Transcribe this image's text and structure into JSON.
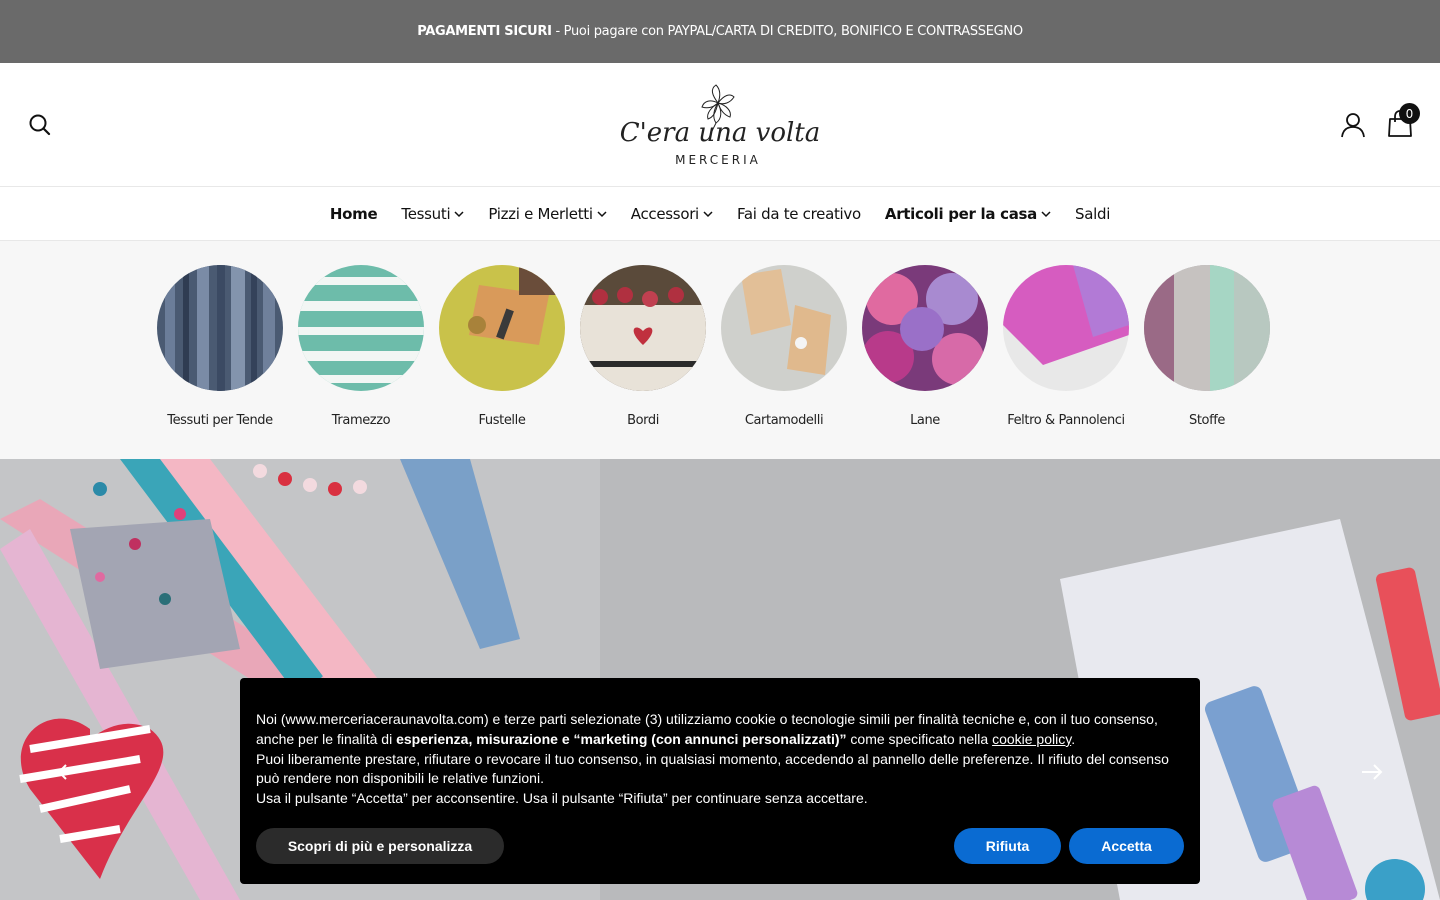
{
  "announcement": {
    "bold": "PAGAMENTI SICURI",
    "text": " - Puoi pagare con PAYPAL/CARTA DI CREDITO, BONIFICO E CONTRASSEGNO"
  },
  "header": {
    "logo_script": "C'era una volta",
    "logo_sub": "MERCERIA",
    "cart_count": "0"
  },
  "nav": {
    "items": [
      {
        "label": "Home"
      },
      {
        "label": "Tessuti"
      },
      {
        "label": "Pizzi e Merletti"
      },
      {
        "label": "Accessori"
      },
      {
        "label": "Fai da te creativo"
      },
      {
        "label": "Articoli per la casa"
      },
      {
        "label": "Saldi"
      }
    ]
  },
  "categories": [
    {
      "label": "Tessuti per Tende"
    },
    {
      "label": "Tramezzo"
    },
    {
      "label": "Fustelle"
    },
    {
      "label": "Bordi"
    },
    {
      "label": "Cartamodelli"
    },
    {
      "label": "Lane"
    },
    {
      "label": "Feltro & Pannolenci"
    },
    {
      "label": "Stoffe"
    }
  ],
  "cookie": {
    "line1": "Noi (www.merceriaceraunavolta.com) e terze parti selezionate (3) utilizziamo cookie o tecnologie simili per finalità tecniche e, con il tuo consenso, anche per le finalità di ",
    "bold": "esperienza, misurazione e “marketing (con annunci personalizzati)”",
    "line1b": " come specificato nella ",
    "link": "cookie policy",
    "line1c": ".",
    "line2": "Puoi liberamente prestare, rifiutare o revocare il tuo consenso, in qualsiasi momento, accedendo al pannello delle preferenze. Il rifiuto del consenso può rendere non disponibili le relative funzioni.",
    "line3": "Usa il pulsante “Accetta” per acconsentire. Usa il pulsante “Rifiuta” per continuare senza accettare.",
    "btn_more": "Scopri di più e personalizza",
    "btn_reject": "Rifiuta",
    "btn_accept": "Accetta"
  }
}
